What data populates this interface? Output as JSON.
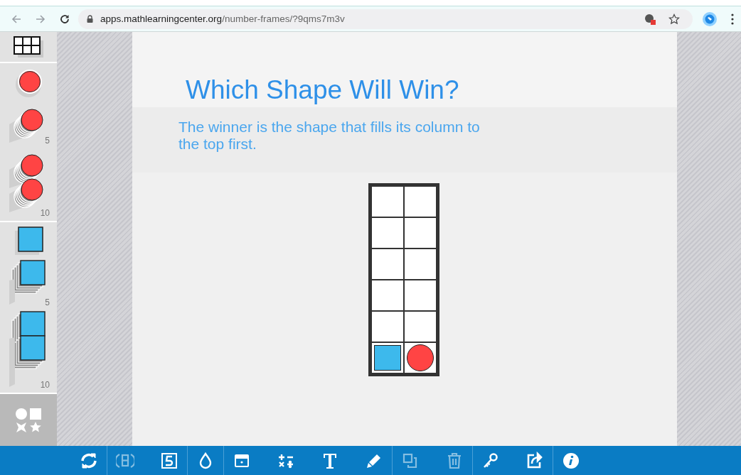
{
  "browser": {
    "url_host": "apps.mathlearningcenter.org",
    "url_path": "/number-frames/?9qms7m3v"
  },
  "sidebar": {
    "sections": [
      {
        "kind": "plain",
        "items": [
          {
            "kind": "grid"
          }
        ]
      },
      {
        "kind": "plain",
        "items": [
          {
            "kind": "circle"
          },
          {
            "kind": "circle-stack",
            "count": "5"
          },
          {
            "kind": "circle-double",
            "count": "10"
          }
        ]
      },
      {
        "kind": "plain",
        "items": [
          {
            "kind": "square"
          },
          {
            "kind": "square-stack",
            "count": "5"
          },
          {
            "kind": "square-double",
            "count": "10"
          }
        ]
      },
      {
        "kind": "dark",
        "items": [
          {
            "kind": "shapes"
          }
        ]
      }
    ]
  },
  "canvas": {
    "title": "Which Shape Will Win?",
    "text": "The winner is the shape that fills its column to the top first.",
    "frame": {
      "rows": [
        [
          {
            "kind": "empty"
          },
          {
            "kind": "empty"
          }
        ],
        [
          {
            "kind": "empty"
          },
          {
            "kind": "empty"
          }
        ],
        [
          {
            "kind": "empty"
          },
          {
            "kind": "empty"
          }
        ],
        [
          {
            "kind": "empty"
          },
          {
            "kind": "empty"
          }
        ],
        [
          {
            "kind": "empty"
          },
          {
            "kind": "empty"
          }
        ],
        [
          {
            "kind": "square"
          },
          {
            "kind": "circle"
          }
        ]
      ]
    }
  },
  "toolbar": {
    "groups": [
      [
        {
          "kind": "refresh",
          "disabled": false
        }
      ],
      [
        {
          "kind": "flip",
          "disabled": true
        },
        {
          "kind": "five",
          "disabled": false
        }
      ],
      [
        {
          "kind": "drop",
          "disabled": false
        }
      ],
      [
        {
          "kind": "card",
          "disabled": false
        },
        {
          "kind": "operators",
          "disabled": false
        },
        {
          "kind": "text",
          "disabled": false
        },
        {
          "kind": "pencil",
          "disabled": false
        }
      ],
      [
        {
          "kind": "duplicate",
          "disabled": true
        },
        {
          "kind": "trash",
          "disabled": true
        }
      ],
      [
        {
          "kind": "key",
          "disabled": false
        },
        {
          "kind": "share",
          "disabled": false
        }
      ],
      [
        {
          "kind": "info",
          "disabled": false
        }
      ]
    ]
  }
}
